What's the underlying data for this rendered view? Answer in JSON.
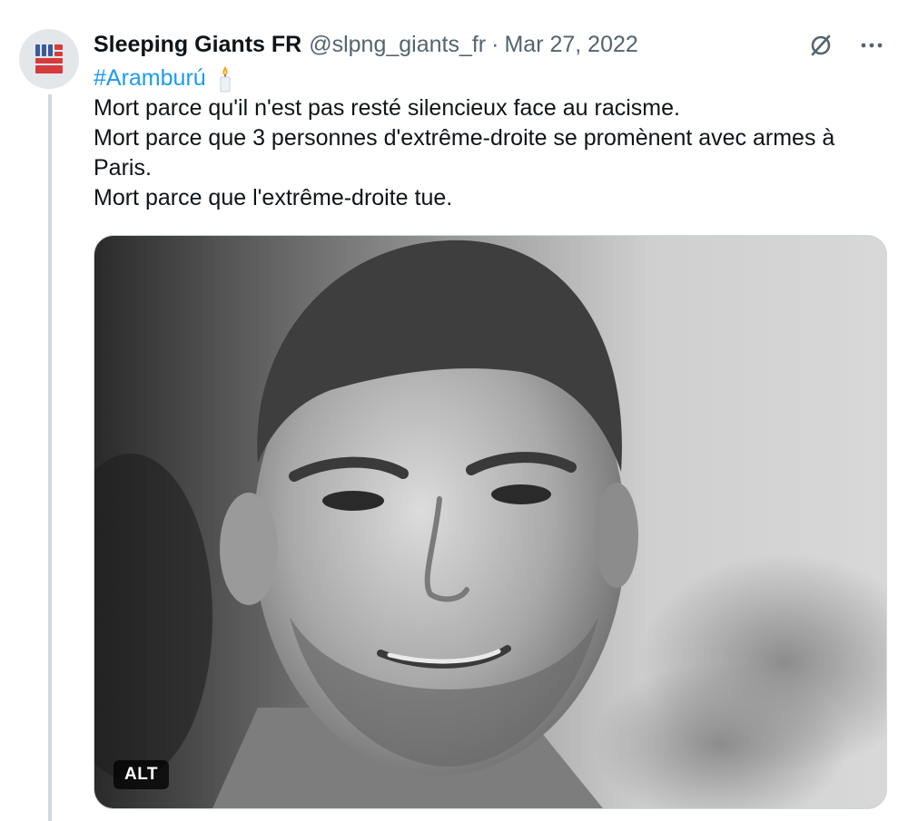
{
  "author": {
    "name": "Sleeping Giants FR",
    "handle": "@slpng_giants_fr",
    "separator": "·",
    "date": "Mar 27, 2022",
    "avatar_icon": "raised-fist-logo-icon"
  },
  "actions": {
    "grok_icon": "slashed-circle-icon",
    "more_icon": "more-dots-icon",
    "more_label": "···"
  },
  "tweet": {
    "hashtag": "#Aramburú",
    "emoji_icon": "candle-icon",
    "lines": [
      "Mort parce qu'il n'est pas resté silencieux face au racisme.",
      "Mort parce que 3 personnes d'extrême-droite se promènent avec armes à Paris.",
      "Mort parce que l'extrême-droite tue."
    ]
  },
  "media": {
    "alt_badge": "ALT"
  },
  "colors": {
    "link": "#1d9bf0",
    "secondary_text": "#536471",
    "thread_line": "#cfd9de",
    "logo_red": "#d63b3b",
    "logo_blue": "#3a5a9a"
  }
}
